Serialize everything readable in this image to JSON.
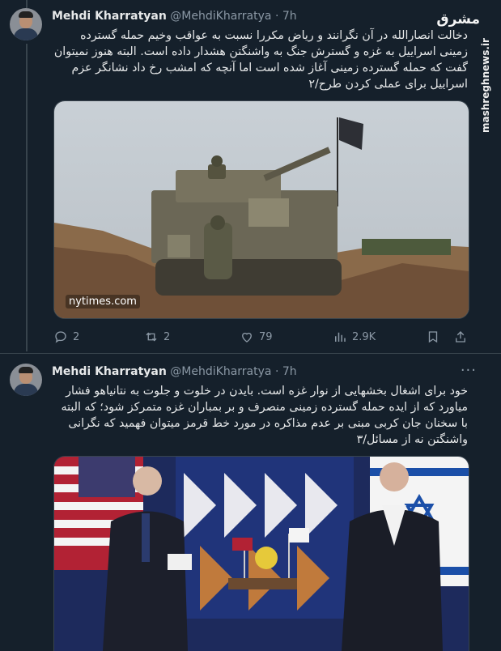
{
  "tweets": [
    {
      "name": "Mehdi Kharratyan",
      "handle": "@MehdiKharratya",
      "time": "7h",
      "text": "دخالت انصارالله در آن نگرانند و ریاض مکررا نسبت به عواقب وخیم حمله گسترده زمینی اسراییل به غزه و گسترش جنگ به واشنگتن هشدار داده است. البته هنوز نمیتوان گفت که حمله گسترده زمینی آغاز  شده است اما آنچه که امشب رخ داد نشانگر عزم اسراییل برای عملی کردن طرح/۲",
      "media_caption": "nytimes.com",
      "stats": {
        "replies": "2",
        "retweets": "2",
        "likes": "79",
        "views": "2.9K"
      }
    },
    {
      "name": "Mehdi Kharratyan",
      "handle": "@MehdiKharratya",
      "time": "7h",
      "text": "خود برای اشغال بخشهایی از نوار غزه است. بایدن در خلوت و جلوت به نتانیاهو فشار میاورد که از ایده حمله گسترده زمینی منصرف و بر بمباران غزه متمرکز شود؛ که البته با سخنان جان کربی مبنی بر عدم مذاکره در مورد خط قرمز میتوان فهمید که نگرانی واشنگتن نه از مسائل/۳"
    }
  ],
  "watermark": {
    "site": "mashreghnews.ir",
    "logo": "مشرق"
  },
  "colors": {
    "background": "#15202b",
    "muted": "#8b98a5",
    "divider": "#38444d"
  }
}
